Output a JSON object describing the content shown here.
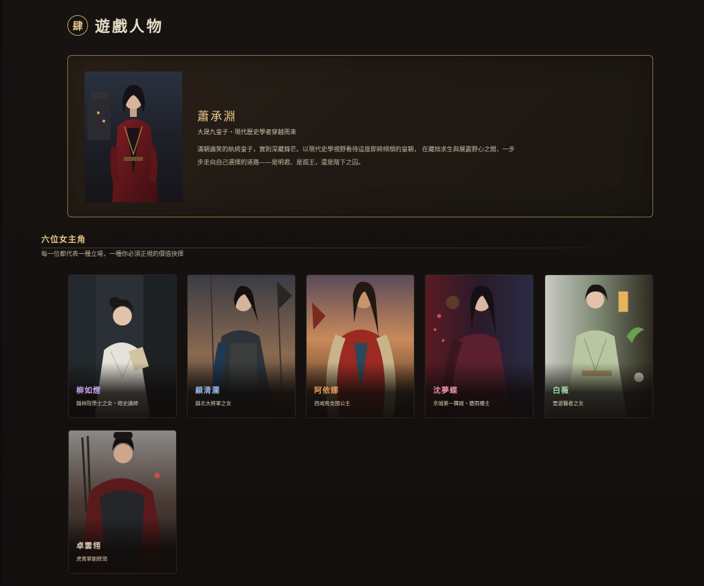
{
  "section": {
    "badge": "肆",
    "title": "遊戲人物"
  },
  "protagonist": {
    "name": "蕭承淵",
    "subtitle": "大晟九皇子・現代歷史學者穿越而來",
    "description": "滿朝譏笑的紈絝皇子，實則深藏鋒芒。以現代史學視野看待這座即將傾頹的皇朝， 在藏拙求生與展露野心之間，一步步走向自己選擇的道路——是明君、是孤王，還是階下之囚。"
  },
  "heroines": {
    "title": "六位女主角",
    "subtitle": "每一位都代表一種立場，一種你必須正視的價值抉擇",
    "cards": [
      {
        "name": "柳如煙",
        "role": "翰林院學士之女・經史講師",
        "name_color": "#c9a7ef"
      },
      {
        "name": "顧清瀾",
        "role": "鎮北大將軍之女",
        "name_color": "#8fb4e8"
      },
      {
        "name": "阿依娜",
        "role": "西域焉支國公主",
        "name_color": "#f09a5c"
      },
      {
        "name": "沈夢蝶",
        "role": "京城第一舞姬・聽雨樓主",
        "name_color": "#e58fae"
      },
      {
        "name": "白薇",
        "role": "雲遊醫者之女",
        "name_color": "#9ed9a6"
      },
      {
        "name": "卓雲翎",
        "role": "虎賁軍副統領",
        "name_color": "#d9ccb6"
      }
    ]
  },
  "colors": {
    "accent_gold": "#e8c58a",
    "card_border": "#8a7147",
    "background": "#151210"
  }
}
